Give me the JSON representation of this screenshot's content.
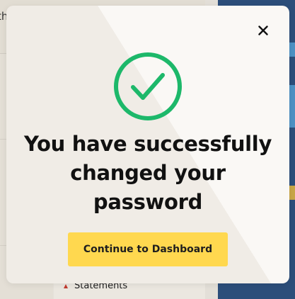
{
  "background": {
    "header_text": "th",
    "nav_item_statements": "Statements",
    "right_panel_color": "#2c4e7a"
  },
  "modal": {
    "close_icon": "close-icon",
    "success_icon": "check-circle-icon",
    "success_color": "#1db86a",
    "message_line1": "You have successfully",
    "message_line2": "changed your",
    "message_line3": "password",
    "cta_label": "Continue to Dashboard",
    "cta_color": "#ffd84f"
  }
}
